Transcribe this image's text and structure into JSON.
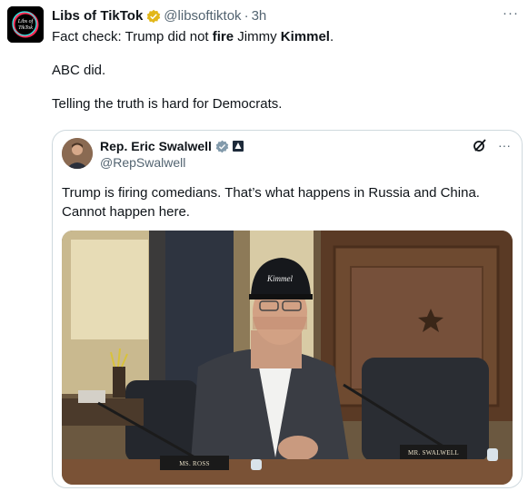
{
  "tweet": {
    "author": "Libs of TikTok",
    "handle": "@libsoftiktok",
    "separator": "·",
    "time": "3h",
    "more": "···",
    "avatar_text_1": "Libs of",
    "avatar_text_2": "TikTok",
    "line1_a": "Fact check: Trump did not ",
    "line1_b": "fire",
    "line1_c": " Jimmy ",
    "line1_d": "Kimmel",
    "line1_e": ".",
    "line2": "ABC did.",
    "line3": "Telling the truth is hard for Democrats."
  },
  "quote": {
    "author": "Rep. Eric Swalwell",
    "handle": "@RepSwalwell",
    "more": "···",
    "text": "Trump is firing comedians. That’s what happens in Russia and China. Cannot happen here.",
    "image": {
      "cap_text": "Kimmel",
      "plate_left": "MS. ROSS",
      "plate_right": "MR. SWALWELL"
    }
  },
  "colors": {
    "verified_gold": "#e2b719",
    "text": "#0f1419",
    "muted": "#536471",
    "border": "#cfd9de"
  },
  "icons": [
    "verified-gold-icon",
    "verified-gray-icon",
    "government-icon",
    "grok-icon",
    "more-icon"
  ]
}
